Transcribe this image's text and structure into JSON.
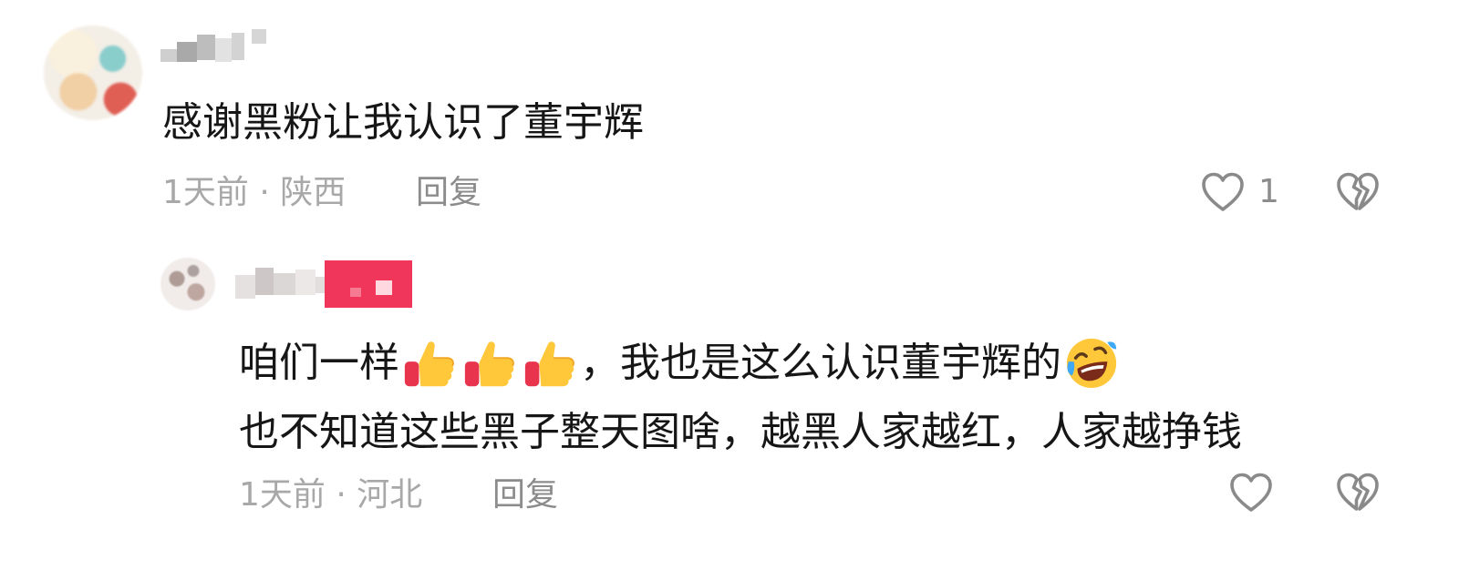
{
  "top_comment": {
    "text": "感谢黑粉让我认识了董宇辉",
    "time": "1天前 · 陕西",
    "reply_label": "回复",
    "like_count": "1",
    "like_icon": "heart-outline-icon",
    "dislike_icon": "broken-heart-icon"
  },
  "reply_comment": {
    "text_part1": "咱们一样",
    "emoji_thumbs": "thumbs-up-emoji",
    "text_part2": "，我也是这么认识董宇辉的",
    "emoji_laugh": "rolling-on-floor-laughing-emoji",
    "text_line2": "也不知道这些黑子整天图啥，越黑人家越红，人家越挣钱",
    "time": "1天前 · 河北",
    "reply_label": "回复",
    "like_icon": "heart-outline-icon",
    "dislike_icon": "broken-heart-icon"
  },
  "colors": {
    "text_primary": "#161616",
    "text_meta": "#a8a8a8",
    "text_action": "#8c8c8c",
    "icon_stroke": "#8a8a8a",
    "name_highlight": "#f0365a"
  }
}
